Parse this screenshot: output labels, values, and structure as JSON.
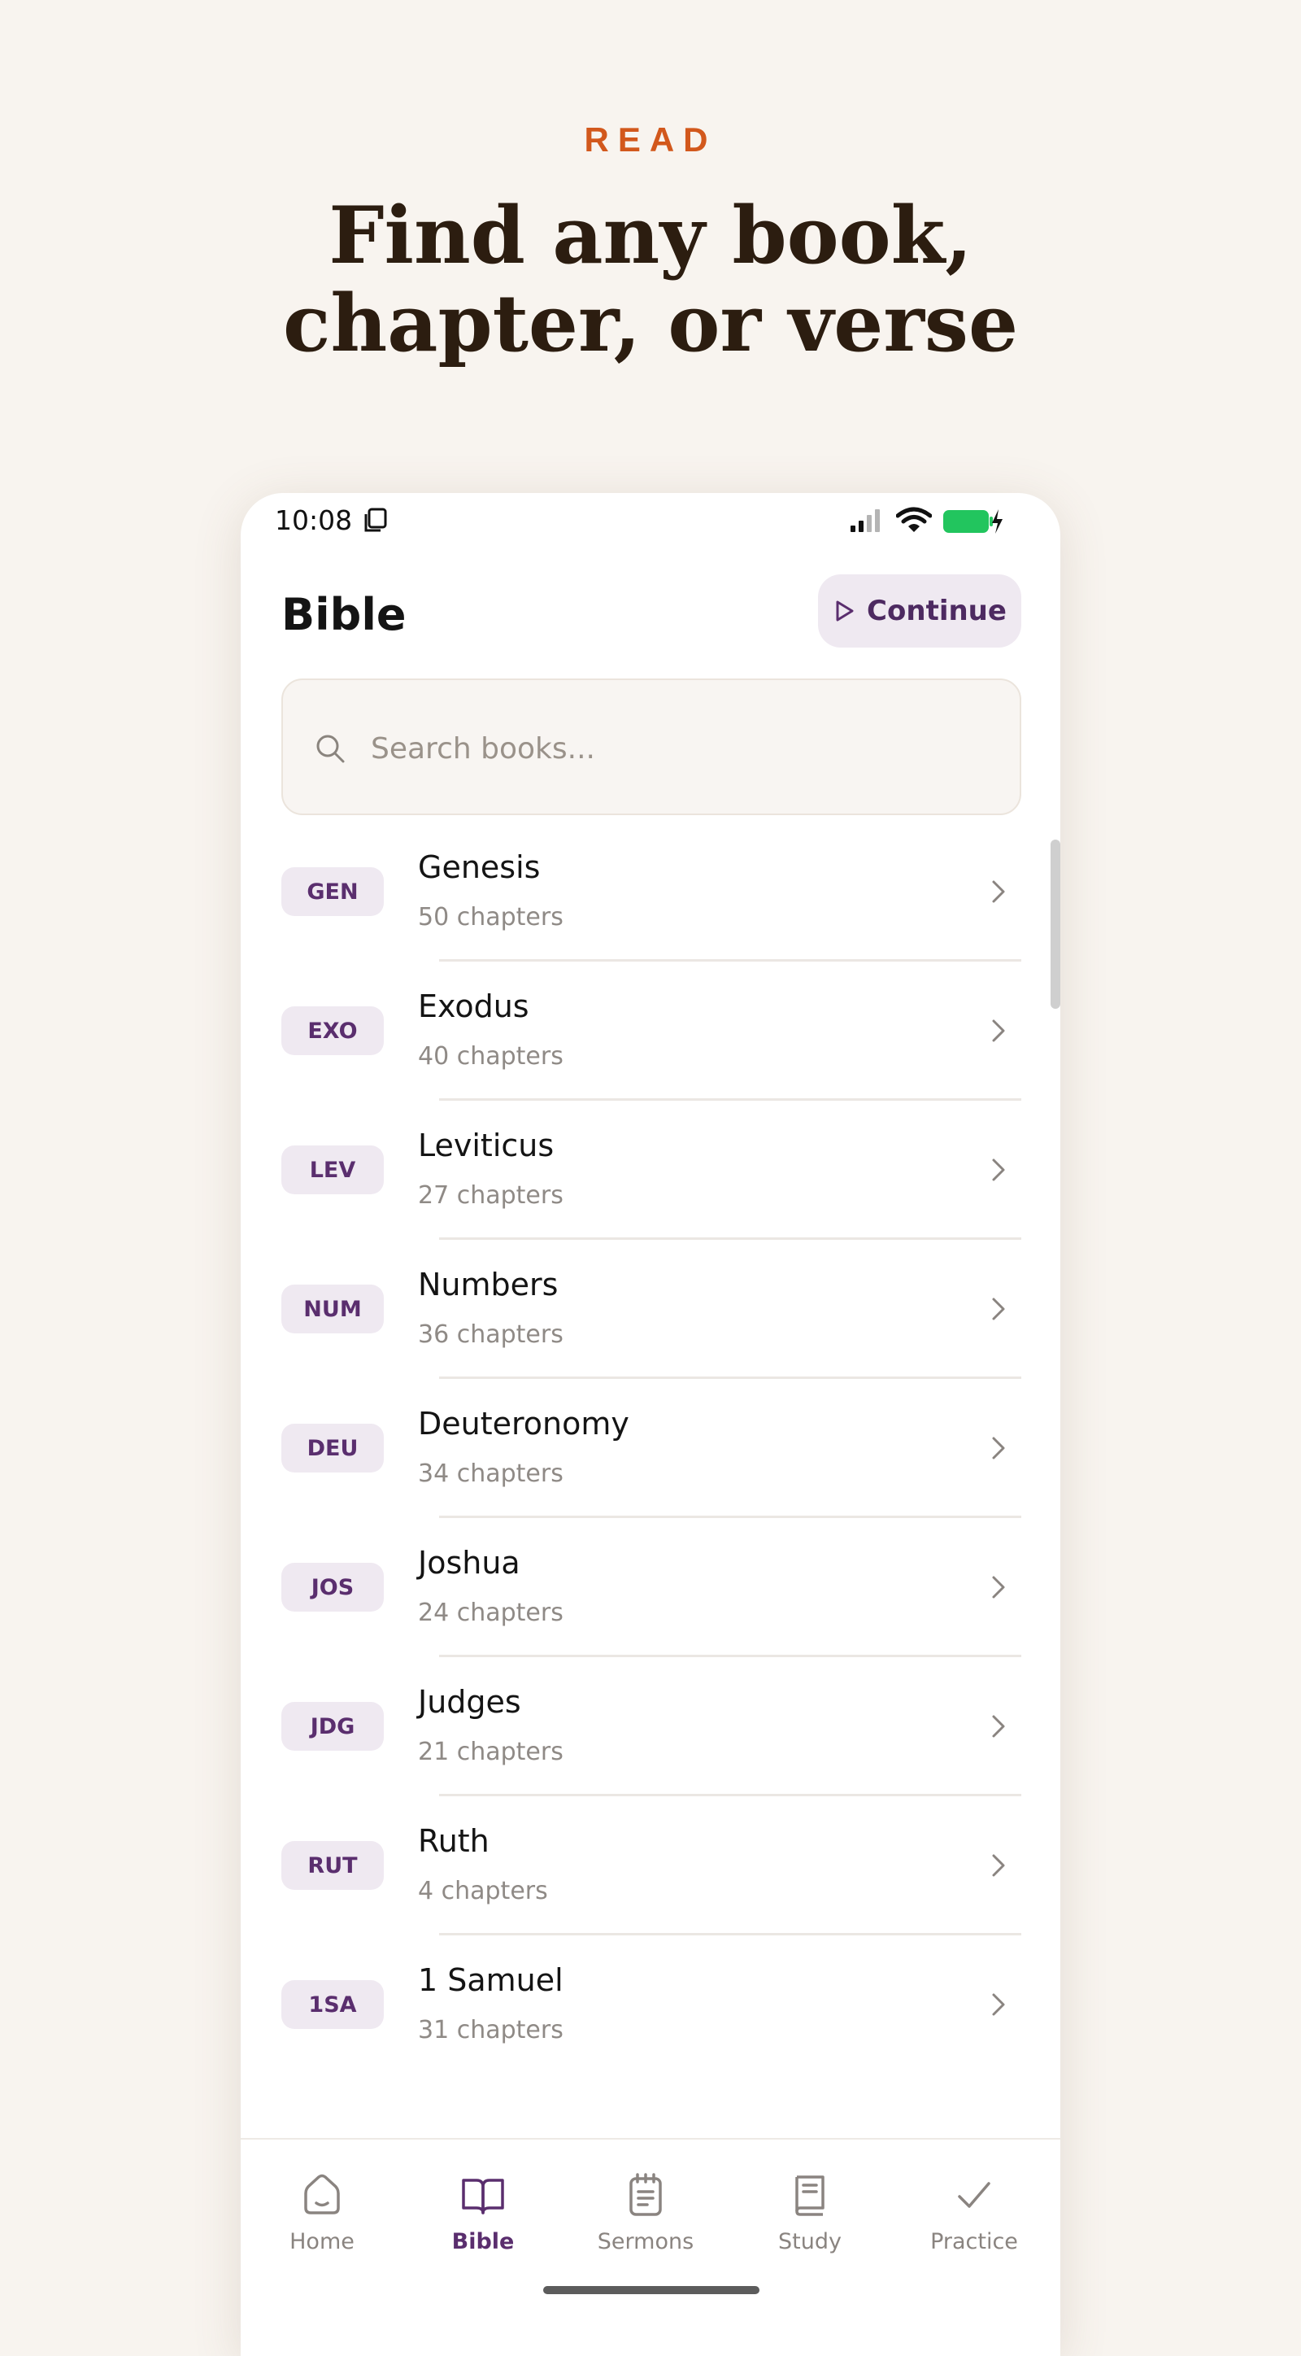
{
  "promo": {
    "eyebrow": "READ",
    "headline_line1": "Find any book,",
    "headline_line2": "chapter, or verse"
  },
  "status_bar": {
    "time": "10:08",
    "icons": [
      "sim-card-icon",
      "signal-icon",
      "wifi-icon",
      "battery-charging-icon"
    ],
    "battery_color": "#22c55e"
  },
  "header": {
    "title": "Bible",
    "continue_label": "Continue",
    "continue_icon": "play-icon"
  },
  "search": {
    "placeholder": "Search books...",
    "value": ""
  },
  "books": [
    {
      "abbr": "GEN",
      "name": "Genesis",
      "chapters": "50 chapters"
    },
    {
      "abbr": "EXO",
      "name": "Exodus",
      "chapters": "40 chapters"
    },
    {
      "abbr": "LEV",
      "name": "Leviticus",
      "chapters": "27 chapters"
    },
    {
      "abbr": "NUM",
      "name": "Numbers",
      "chapters": "36 chapters"
    },
    {
      "abbr": "DEU",
      "name": "Deuteronomy",
      "chapters": "34 chapters"
    },
    {
      "abbr": "JOS",
      "name": "Joshua",
      "chapters": "24 chapters"
    },
    {
      "abbr": "JDG",
      "name": "Judges",
      "chapters": "21 chapters"
    },
    {
      "abbr": "RUT",
      "name": "Ruth",
      "chapters": "4 chapters"
    },
    {
      "abbr": "1SA",
      "name": "1 Samuel",
      "chapters": "31 chapters"
    }
  ],
  "bottom_nav": {
    "items": [
      {
        "label": "Home",
        "icon": "home-icon",
        "active": false
      },
      {
        "label": "Bible",
        "icon": "open-book-icon",
        "active": true
      },
      {
        "label": "Sermons",
        "icon": "notepad-icon",
        "active": false
      },
      {
        "label": "Study",
        "icon": "book-icon",
        "active": false
      },
      {
        "label": "Practice",
        "icon": "check-icon",
        "active": false
      }
    ]
  },
  "colors": {
    "accent": "#5a2e6e",
    "eyebrow": "#d2581c",
    "background": "#f8f4ef"
  }
}
